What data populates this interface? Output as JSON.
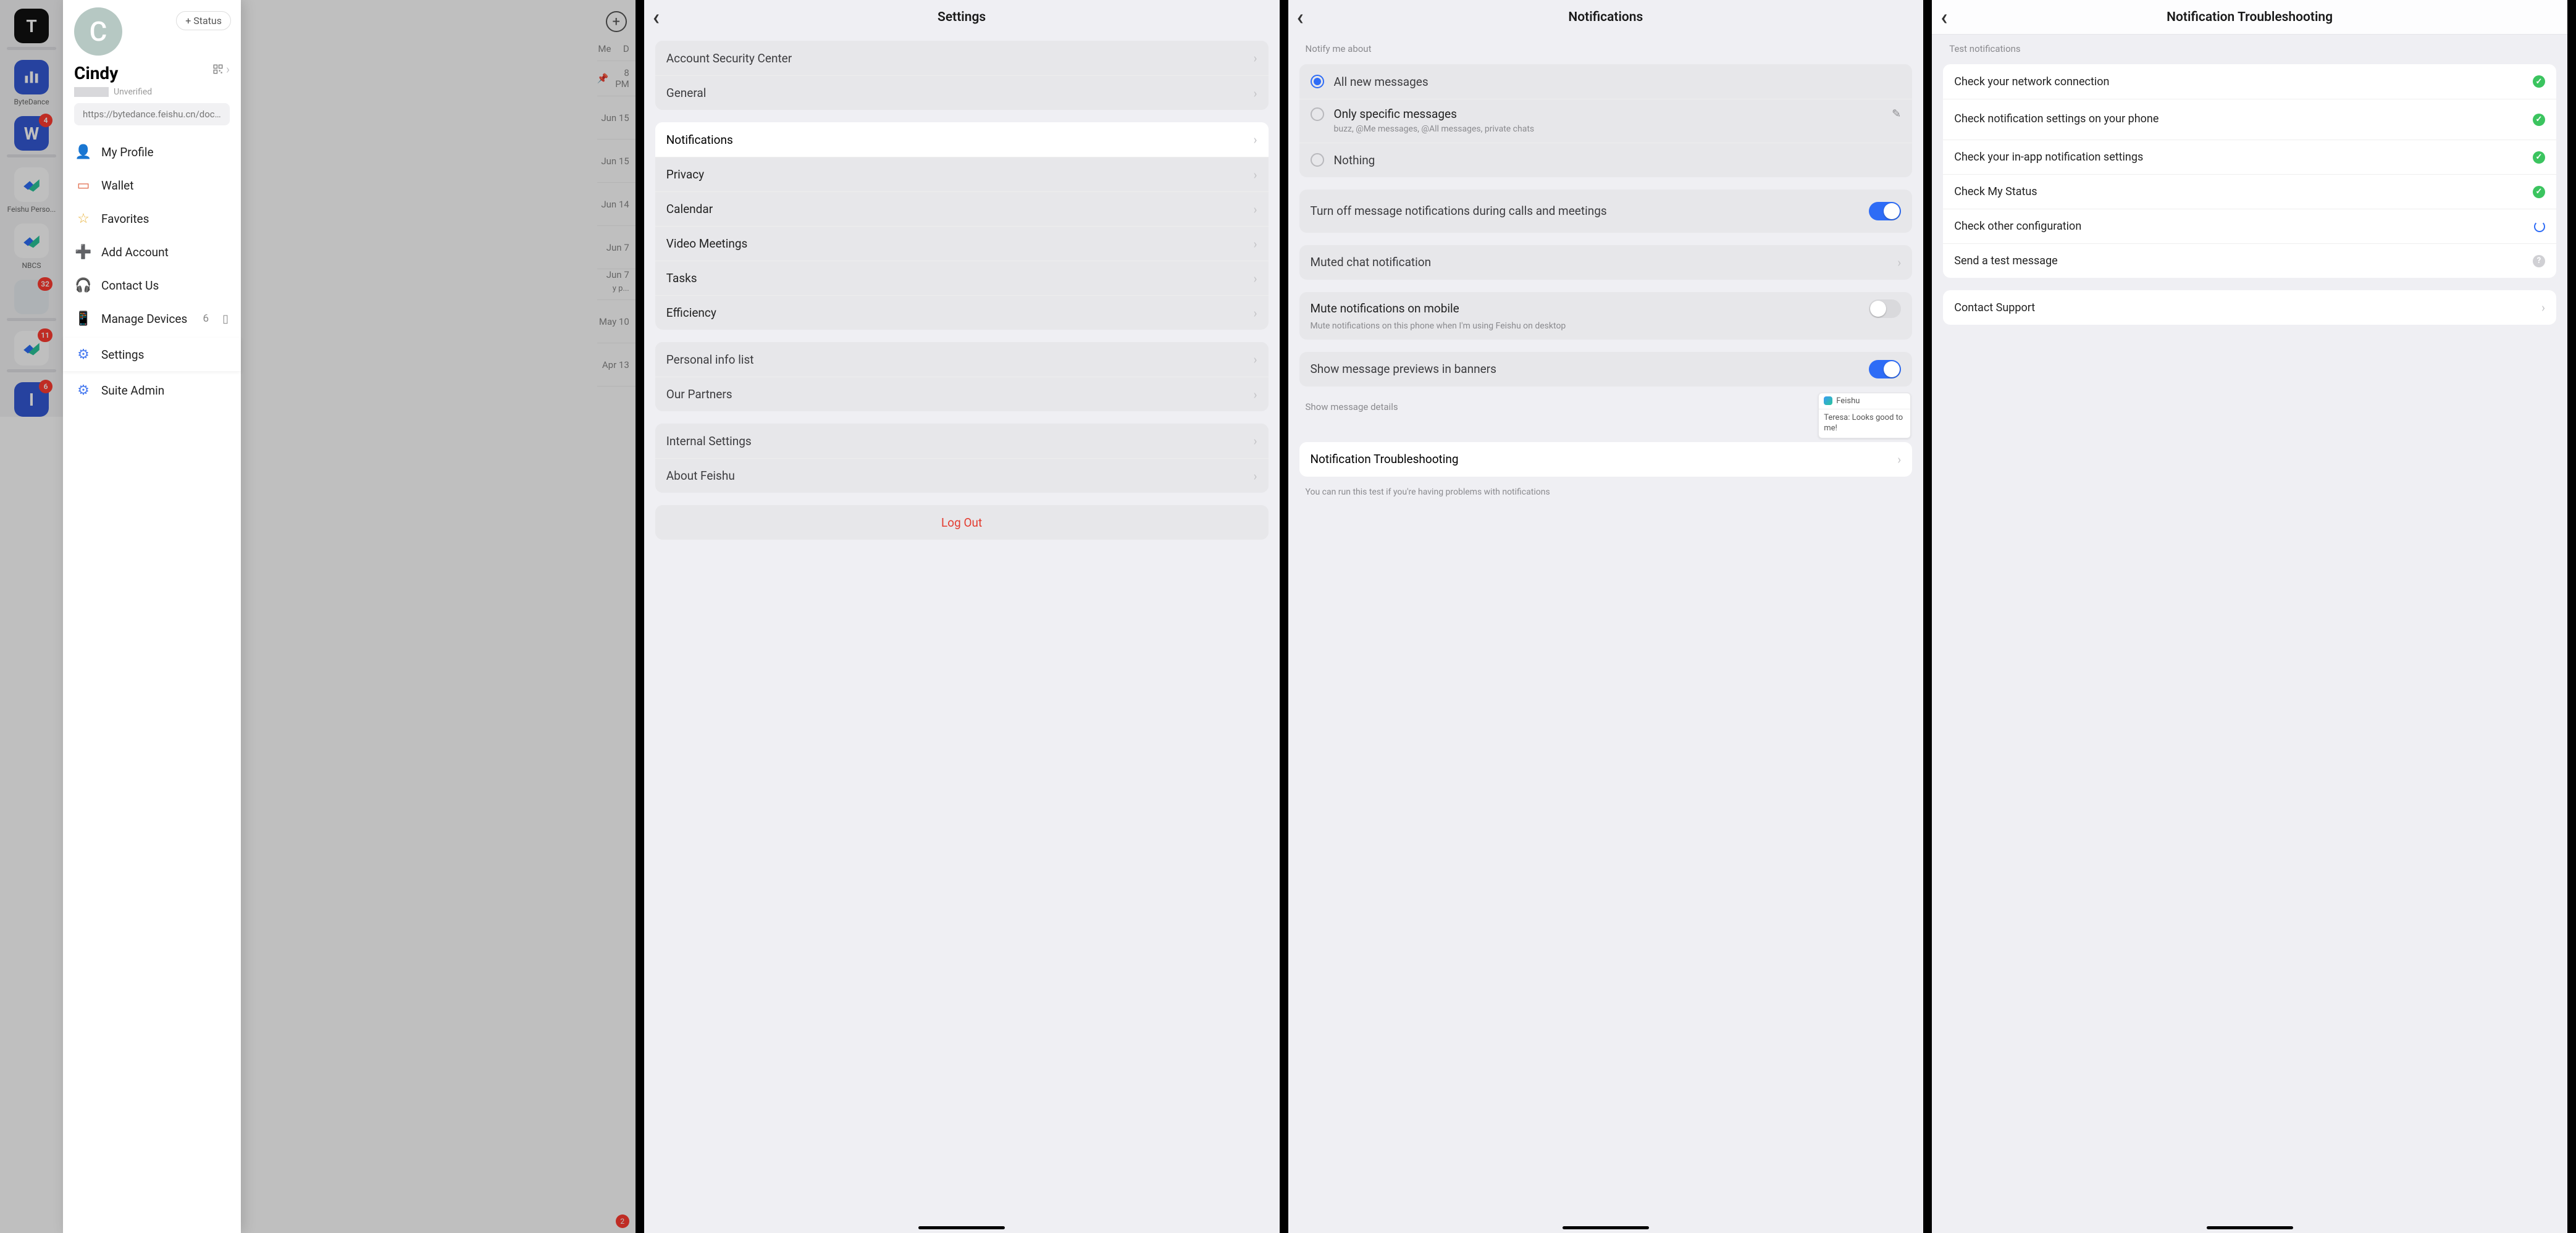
{
  "phone1": {
    "add_status": "+ Status",
    "name": "Cindy",
    "unverified": "Unverified",
    "link": "https://bytedance.feishu.cn/docs...",
    "menu": {
      "profile": "My Profile",
      "wallet": "Wallet",
      "favorites": "Favorites",
      "add_account": "Add Account",
      "contact_us": "Contact Us",
      "manage_devices": "Manage Devices",
      "device_count": "6",
      "settings": "Settings",
      "suite_admin": "Suite Admin"
    },
    "rail": {
      "t_letter": "T",
      "bytedance": "ByteDance",
      "w_letter": "W",
      "w_badge": "4",
      "feishu_personal": "Feishu Perso...",
      "nbcs": "NBCS",
      "map_badge": "32",
      "mail_badge": "11",
      "i_letter": "I",
      "i_badge": "6"
    },
    "bg_list": {
      "tabs_me": "Me",
      "tabs_d": "D",
      "r0": "8 PM",
      "r1": "Jun 15",
      "r2": "Jun 15",
      "r3": "Jun 14",
      "r4": "Jun 7",
      "r5": "Jun 7",
      "r5b": "y p...",
      "r6": "May 10",
      "r7": "Apr 13",
      "badge2": "2"
    }
  },
  "phone2": {
    "title": "Settings",
    "items": {
      "security": "Account Security Center",
      "general": "General",
      "notifications": "Notifications",
      "privacy": "Privacy",
      "calendar": "Calendar",
      "video": "Video Meetings",
      "tasks": "Tasks",
      "efficiency": "Efficiency",
      "personal_info": "Personal info list",
      "partners": "Our Partners",
      "internal": "Internal Settings",
      "about": "About Feishu",
      "logout": "Log Out"
    }
  },
  "phone3": {
    "title": "Notifications",
    "notify_header": "Notify me about",
    "opts": {
      "all": "All new messages",
      "specific": "Only specific messages",
      "specific_desc": "buzz, @Me messages, @All messages, private chats",
      "nothing": "Nothing"
    },
    "turn_off": "Turn off message notifications during calls and meetings",
    "muted": "Muted chat notification",
    "mute_mobile": "Mute notifications on mobile",
    "mute_mobile_desc": "Mute notifications on this phone when I'm using Feishu on desktop",
    "show_preview": "Show message previews in banners",
    "show_details": "Show message details",
    "preview_app": "Feishu",
    "preview_msg": "Teresa: Looks good to me!",
    "troubleshoot": "Notification Troubleshooting",
    "troubleshoot_note": "You can run this test if you're having problems with notifications"
  },
  "phone4": {
    "title": "Notification Troubleshooting",
    "section": "Test notifications",
    "items": {
      "net": "Check your network connection",
      "phone_settings": "Check notification settings on your phone",
      "inapp": "Check your in-app notification settings",
      "status": "Check My Status",
      "other": "Check other configuration",
      "test_msg": "Send a test message"
    },
    "contact": "Contact Support"
  }
}
